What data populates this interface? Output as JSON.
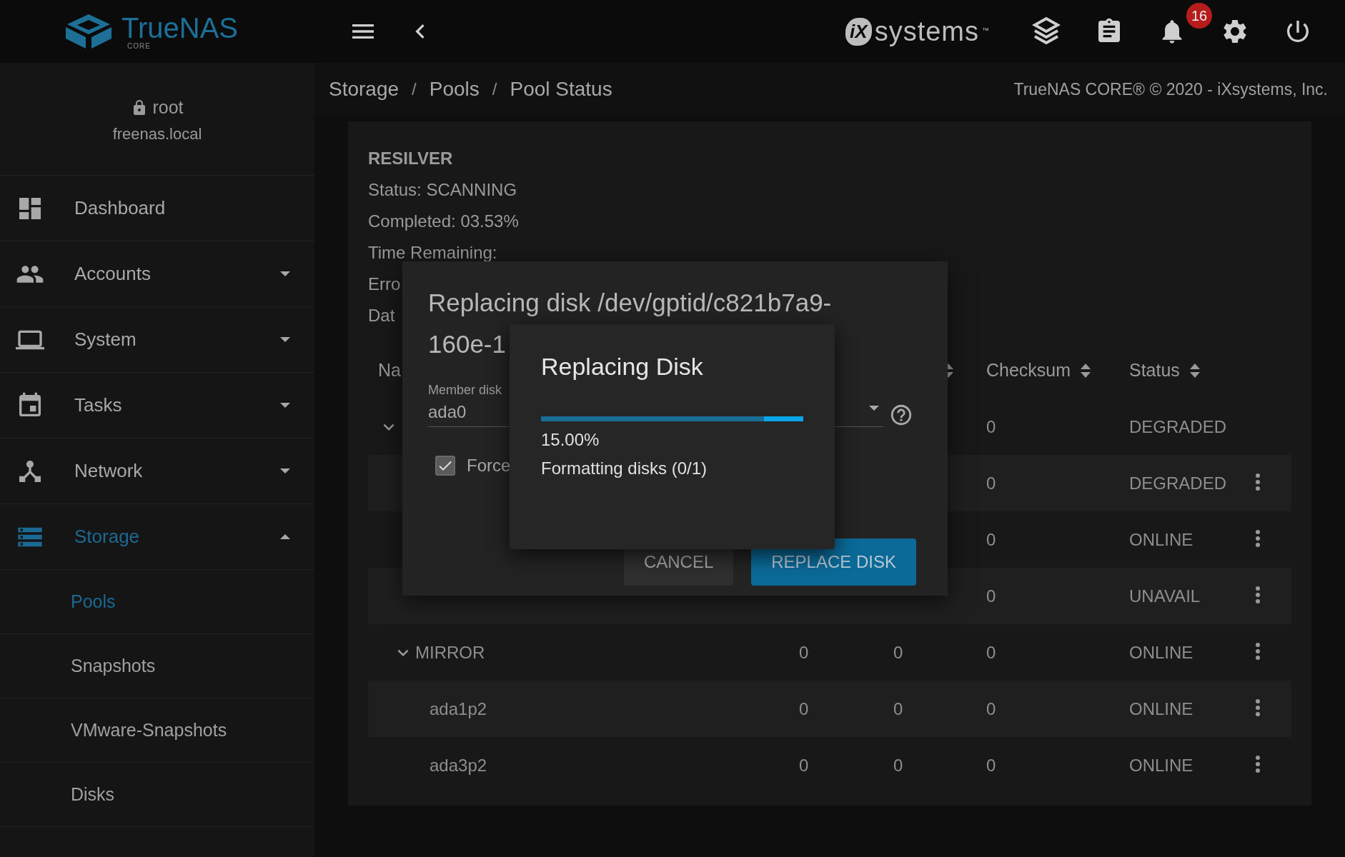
{
  "header": {
    "logo": {
      "name": "TrueNAS",
      "edition": "CORE"
    },
    "vendor_logo": {
      "mark": "iX",
      "name": "systems",
      "tm": "™"
    },
    "notifications": {
      "count": "16"
    }
  },
  "sidebar": {
    "user": {
      "name": "root",
      "host": "freenas.local"
    },
    "items": [
      {
        "label": "Dashboard",
        "selected": false
      },
      {
        "label": "Accounts",
        "selected": false,
        "expanded": false
      },
      {
        "label": "System",
        "selected": false,
        "expanded": false
      },
      {
        "label": "Tasks",
        "selected": false,
        "expanded": false
      },
      {
        "label": "Network",
        "selected": false,
        "expanded": false
      },
      {
        "label": "Storage",
        "selected": true,
        "expanded": true,
        "children": [
          {
            "label": "Pools",
            "selected": true
          },
          {
            "label": "Snapshots",
            "selected": false
          },
          {
            "label": "VMware-Snapshots",
            "selected": false
          },
          {
            "label": "Disks",
            "selected": false
          }
        ]
      }
    ]
  },
  "breadcrumb": {
    "separator": "/",
    "items": [
      "Storage",
      "Pools",
      "Pool Status"
    ]
  },
  "copyright": "TrueNAS CORE® © 2020 - iXsystems, Inc.",
  "resilver": {
    "heading": "RESILVER",
    "lines": [
      "Status: SCANNING",
      "Completed: 03.53%",
      "Time Remaining:",
      "Erro",
      "Dat"
    ]
  },
  "table": {
    "columns": [
      {
        "label": "Na"
      },
      {
        "label": "Checksum"
      },
      {
        "label": "Status"
      }
    ],
    "rows": [
      {
        "kind": "group",
        "expanded": true,
        "checksum": "0",
        "status": "DEGRADED",
        "menu": false
      },
      {
        "kind": "disk",
        "checksum": "0",
        "status": "DEGRADED",
        "menu": true
      },
      {
        "kind": "disk",
        "checksum": "0",
        "status": "ONLINE",
        "menu": true
      },
      {
        "kind": "disk",
        "checksum": "0",
        "status": "UNAVAIL",
        "menu": true
      },
      {
        "kind": "group",
        "expanded": true,
        "name": "MIRROR",
        "read": "0",
        "write": "0",
        "checksum": "0",
        "status": "ONLINE",
        "menu": true
      },
      {
        "kind": "disk",
        "name": "ada1p2",
        "read": "0",
        "write": "0",
        "checksum": "0",
        "status": "ONLINE",
        "menu": true
      },
      {
        "kind": "disk",
        "name": "ada3p2",
        "read": "0",
        "write": "0",
        "checksum": "0",
        "status": "ONLINE",
        "menu": true
      }
    ]
  },
  "replace_dialog": {
    "title_lines": [
      "Replacing disk /dev/gptid/c821b7a9-",
      "160e-1"
    ],
    "member_disk": {
      "label": "Member disk",
      "value": "ada0"
    },
    "force": {
      "label": "Force",
      "checked": true
    },
    "buttons": [
      {
        "label": "CANCEL",
        "kind": "plain"
      },
      {
        "label": "REPLACE DISK",
        "kind": "primary"
      }
    ]
  },
  "progress_dialog": {
    "title": "Replacing Disk",
    "level": 0.15,
    "percent": "15.00%",
    "message": "Formatting disks (0/1)"
  }
}
